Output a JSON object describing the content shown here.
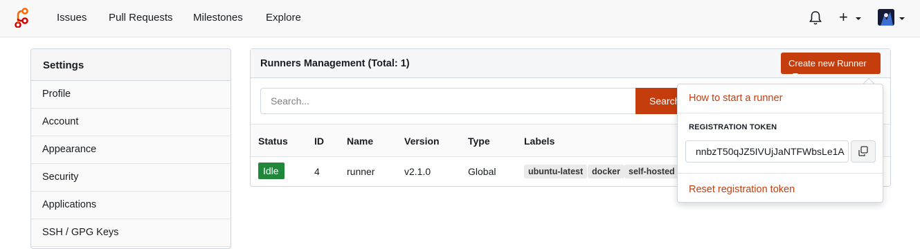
{
  "nav": {
    "items": [
      "Issues",
      "Pull Requests",
      "Milestones",
      "Explore"
    ],
    "plus_label": "+"
  },
  "settings": {
    "title": "Settings",
    "items": [
      "Profile",
      "Account",
      "Appearance",
      "Security",
      "Applications",
      "SSH / GPG Keys"
    ]
  },
  "runners": {
    "title": "Runners Management (Total: 1)",
    "create_label": "Create new Runner",
    "search_placeholder": "Search...",
    "search_button": "Search",
    "columns": [
      "Status",
      "ID",
      "Name",
      "Version",
      "Type",
      "Labels"
    ],
    "rows": [
      {
        "status": "Idle",
        "id": "4",
        "name": "runner",
        "version": "v2.1.0",
        "type": "Global",
        "labels": [
          "ubuntu-latest",
          "docker",
          "self-hosted"
        ]
      }
    ]
  },
  "dropdown": {
    "how_to": "How to start a runner",
    "token_label": "REGISTRATION TOKEN",
    "token_value": "nnbzT50qJZ5IVUjJaNTFWbsLe1A",
    "reset": "Reset registration token"
  },
  "colors": {
    "accent": "#c53d0c",
    "idle": "#21873b"
  }
}
